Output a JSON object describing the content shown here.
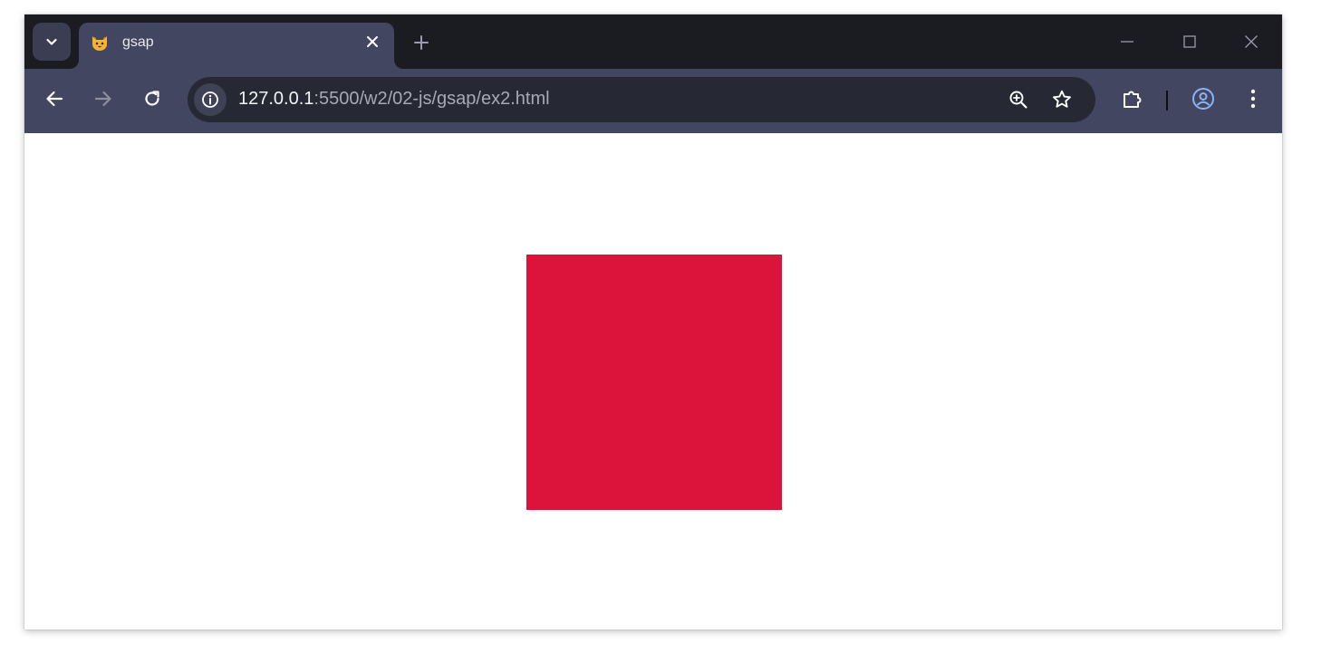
{
  "tab": {
    "title": "gsap",
    "favicon": "cat-face-icon"
  },
  "address_bar": {
    "host": "127.0.0.1",
    "rest": ":5500/w2/02-js/gsap/ex2.html"
  },
  "icons": {
    "tab_search": "chevron-down-icon",
    "tab_close": "close-icon",
    "new_tab": "plus-icon",
    "minimize": "minimize-icon",
    "maximize": "maximize-icon",
    "close_window": "close-icon",
    "back": "arrow-left-icon",
    "forward": "arrow-right-icon",
    "reload": "reload-icon",
    "site_info": "info-icon",
    "zoom": "zoom-in-icon",
    "bookmark": "star-icon",
    "extensions": "puzzle-icon",
    "profile": "account-circle-icon",
    "menu": "vertical-dots-icon"
  },
  "colors": {
    "box": "#dc143c",
    "tabstrip": "#1b1c22",
    "toolbar": "#434660",
    "profile_accent": "#8ab4f8"
  }
}
